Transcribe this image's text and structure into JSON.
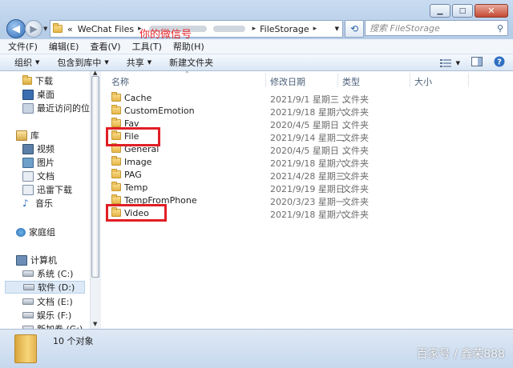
{
  "window": {
    "minimize": "▁",
    "maximize": "□",
    "close": "✕"
  },
  "address": {
    "prefix": "«",
    "crumbs": [
      "WeChat Files",
      "FileStorage"
    ],
    "annotation": "你的微信号"
  },
  "search": {
    "placeholder": "搜索 FileStorage"
  },
  "menu": [
    "文件(F)",
    "编辑(E)",
    "查看(V)",
    "工具(T)",
    "帮助(H)"
  ],
  "toolbar": {
    "organize": "组织",
    "include": "包含到库中",
    "share": "共享",
    "new_folder": "新建文件夹"
  },
  "nav": {
    "items": [
      {
        "label": "下载",
        "icon": "download-folder-icon"
      },
      {
        "label": "桌面",
        "icon": "desktop-icon"
      },
      {
        "label": "最近访问的位置",
        "icon": "recent-places-icon"
      },
      {
        "label": "库",
        "icon": "library-icon"
      },
      {
        "label": "视频",
        "icon": "video-library-icon"
      },
      {
        "label": "图片",
        "icon": "picture-library-icon"
      },
      {
        "label": "文档",
        "icon": "document-library-icon"
      },
      {
        "label": "迅雷下载",
        "icon": "thunder-download-icon"
      },
      {
        "label": "音乐",
        "icon": "music-library-icon"
      },
      {
        "label": "家庭组",
        "icon": "homegroup-icon"
      },
      {
        "label": "计算机",
        "icon": "computer-icon"
      },
      {
        "label": "系统 (C:)",
        "icon": "drive-c-icon"
      },
      {
        "label": "软件 (D:)",
        "icon": "drive-d-icon"
      },
      {
        "label": "文档 (E:)",
        "icon": "drive-e-icon"
      },
      {
        "label": "娱乐 (F:)",
        "icon": "drive-f-icon"
      },
      {
        "label": "新加卷 (G:)",
        "icon": "drive-g-icon"
      }
    ]
  },
  "columns": {
    "name": "名称",
    "date": "修改日期",
    "type": "类型",
    "size": "大小"
  },
  "files": [
    {
      "name": "Cache",
      "date": "2021/9/1 星期三 ...",
      "type": "文件夹"
    },
    {
      "name": "CustomEmotion",
      "date": "2021/9/18 星期六 ...",
      "type": "文件夹"
    },
    {
      "name": "Fav",
      "date": "2020/4/5 星期日 ...",
      "type": "文件夹"
    },
    {
      "name": "File",
      "date": "2021/9/14 星期二 ...",
      "type": "文件夹"
    },
    {
      "name": "General",
      "date": "2020/4/5 星期日 ...",
      "type": "文件夹"
    },
    {
      "name": "Image",
      "date": "2021/9/18 星期六 ...",
      "type": "文件夹"
    },
    {
      "name": "PAG",
      "date": "2021/4/28 星期三 ...",
      "type": "文件夹"
    },
    {
      "name": "Temp",
      "date": "2021/9/19 星期日 ...",
      "type": "文件夹"
    },
    {
      "name": "TempFromPhone",
      "date": "2020/3/23 星期一 ...",
      "type": "文件夹"
    },
    {
      "name": "Video",
      "date": "2021/9/18 星期六 ...",
      "type": "文件夹"
    }
  ],
  "status": {
    "count": "10 个对象"
  },
  "watermark": "百家号 / 鑫荣888"
}
